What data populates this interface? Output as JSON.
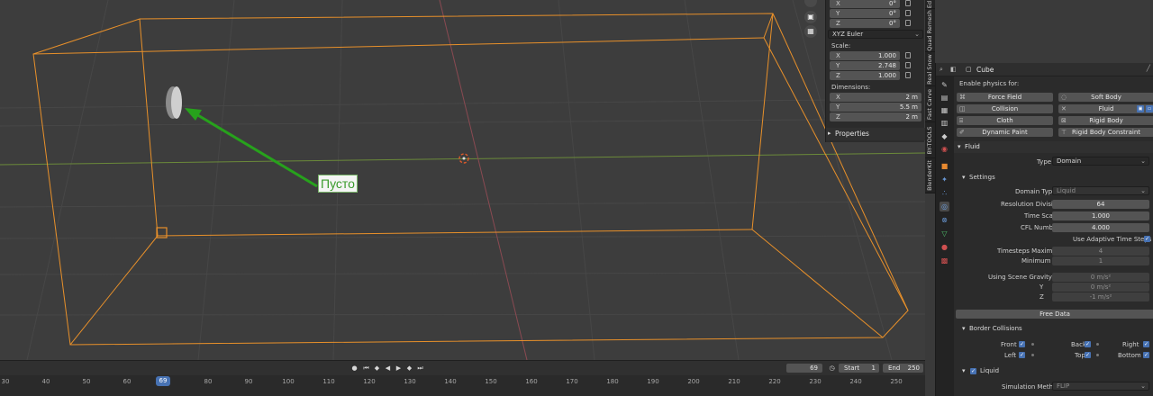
{
  "viewport": {
    "callout_text": "Пусто"
  },
  "n_panel": {
    "rotation": {
      "x": "0°",
      "y": "0°",
      "z": "0°"
    },
    "rotation_mode": "XYZ Euler",
    "scale_label": "Scale:",
    "scale": {
      "x": "1.000",
      "y": "2.748",
      "z": "1.000"
    },
    "dimensions_label": "Dimensions:",
    "dimensions": {
      "x": "2 m",
      "y": "5.5 m",
      "z": "2 m"
    },
    "axis_x": "X",
    "axis_y": "Y",
    "axis_z": "Z",
    "properties_label": "Properties"
  },
  "side_tabs": [
    "BlenderKit",
    "BY-TOOLS",
    "Fast Carve",
    "Real Snow",
    "Quad Remesh",
    "Ed"
  ],
  "properties": {
    "object_name": "Cube",
    "enable_physics_label": "Enable physics for:",
    "physics_buttons": [
      {
        "label": "Force Field",
        "icon": "force-field-icon"
      },
      {
        "label": "Soft Body",
        "icon": "soft-body-icon"
      },
      {
        "label": "Collision",
        "icon": "collision-icon"
      },
      {
        "label": "Fluid",
        "icon": "fluid-icon"
      },
      {
        "label": "Cloth",
        "icon": "cloth-icon"
      },
      {
        "label": "Rigid Body",
        "icon": "rigid-body-icon"
      },
      {
        "label": "Dynamic Paint",
        "icon": "dynamic-paint-icon"
      },
      {
        "label": "Rigid Body Constraint",
        "icon": "rigid-body-constraint-icon"
      }
    ],
    "fluid_header": "Fluid",
    "type_label": "Type",
    "type_value": "Domain",
    "settings_header": "Settings",
    "domain_type_label": "Domain Type",
    "domain_type_value": "Liquid",
    "resolution_label": "Resolution Divisions",
    "resolution_value": "64",
    "time_scale_label": "Time Scale",
    "time_scale_value": "1.000",
    "cfl_label": "CFL Number",
    "cfl_value": "4.000",
    "adaptive_label": "Use Adaptive Time Steps",
    "timesteps_max_label": "Timesteps Maximum",
    "timesteps_max_value": "4",
    "minimum_label": "Minimum",
    "minimum_value": "1",
    "gravity_label": "Using Scene Gravity X",
    "gravity_x": "0 m/s²",
    "gravity_y_label": "Y",
    "gravity_y": "0 m/s²",
    "gravity_z_label": "Z",
    "gravity_z": "-1 m/s²",
    "free_data_label": "Free Data",
    "border_header": "Border Collisions",
    "border": {
      "front": "Front",
      "back": "Back",
      "right": "Right",
      "left": "Left",
      "top": "Top",
      "bottom": "Bottom"
    },
    "liquid_header": "Liquid",
    "sim_method_label": "Simulation Method",
    "sim_method_value": "FLIP"
  },
  "timeline": {
    "current_frame": "69",
    "start_label": "Start",
    "start_value": "1",
    "end_label": "End",
    "end_value": "250",
    "ruler": [
      "30",
      "40",
      "50",
      "60",
      "69",
      "80",
      "90",
      "100",
      "110",
      "120",
      "130",
      "140",
      "150",
      "160",
      "170",
      "180",
      "190",
      "200",
      "210",
      "220",
      "230",
      "240",
      "250"
    ]
  },
  "colors": {
    "selection_orange": "#e8902a",
    "accent_blue": "#4772b3",
    "arrow_green": "#27a21c"
  }
}
